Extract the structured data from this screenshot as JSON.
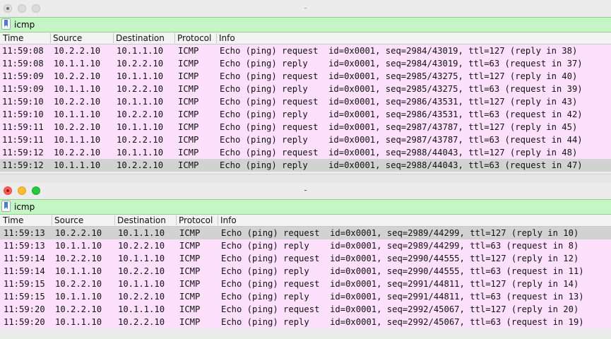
{
  "windows": [
    {
      "title": "-",
      "active": false,
      "filter": "icmp",
      "columns": [
        "Time",
        "Source",
        "Destination",
        "Protocol",
        "Info"
      ],
      "rows": [
        {
          "time": "11:59:08",
          "src": "10.2.2.10",
          "dst": "10.1.1.10",
          "proto": "ICMP",
          "info": "Echo (ping) request  id=0x0001, seq=2984/43019, ttl=127 (reply in 38)",
          "selected": false
        },
        {
          "time": "11:59:08",
          "src": "10.1.1.10",
          "dst": "10.2.2.10",
          "proto": "ICMP",
          "info": "Echo (ping) reply    id=0x0001, seq=2984/43019, ttl=63 (request in 37)",
          "selected": false
        },
        {
          "time": "11:59:09",
          "src": "10.2.2.10",
          "dst": "10.1.1.10",
          "proto": "ICMP",
          "info": "Echo (ping) request  id=0x0001, seq=2985/43275, ttl=127 (reply in 40)",
          "selected": false
        },
        {
          "time": "11:59:09",
          "src": "10.1.1.10",
          "dst": "10.2.2.10",
          "proto": "ICMP",
          "info": "Echo (ping) reply    id=0x0001, seq=2985/43275, ttl=63 (request in 39)",
          "selected": false
        },
        {
          "time": "11:59:10",
          "src": "10.2.2.10",
          "dst": "10.1.1.10",
          "proto": "ICMP",
          "info": "Echo (ping) request  id=0x0001, seq=2986/43531, ttl=127 (reply in 43)",
          "selected": false
        },
        {
          "time": "11:59:10",
          "src": "10.1.1.10",
          "dst": "10.2.2.10",
          "proto": "ICMP",
          "info": "Echo (ping) reply    id=0x0001, seq=2986/43531, ttl=63 (request in 42)",
          "selected": false
        },
        {
          "time": "11:59:11",
          "src": "10.2.2.10",
          "dst": "10.1.1.10",
          "proto": "ICMP",
          "info": "Echo (ping) request  id=0x0001, seq=2987/43787, ttl=127 (reply in 45)",
          "selected": false
        },
        {
          "time": "11:59:11",
          "src": "10.1.1.10",
          "dst": "10.2.2.10",
          "proto": "ICMP",
          "info": "Echo (ping) reply    id=0x0001, seq=2987/43787, ttl=63 (request in 44)",
          "selected": false
        },
        {
          "time": "11:59:12",
          "src": "10.2.2.10",
          "dst": "10.1.1.10",
          "proto": "ICMP",
          "info": "Echo (ping) request  id=0x0001, seq=2988/44043, ttl=127 (reply in 48)",
          "selected": false
        },
        {
          "time": "11:59:12",
          "src": "10.1.1.10",
          "dst": "10.2.2.10",
          "proto": "ICMP",
          "info": "Echo (ping) reply    id=0x0001, seq=2988/44043, ttl=63 (request in 47)",
          "selected": true
        }
      ]
    },
    {
      "title": "-",
      "active": true,
      "filter": "icmp",
      "columns": [
        "Time",
        "Source",
        "Destination",
        "Protocol",
        "Info"
      ],
      "rows": [
        {
          "time": "11:59:13",
          "src": "10.2.2.10",
          "dst": "10.1.1.10",
          "proto": "ICMP",
          "info": "Echo (ping) request  id=0x0001, seq=2989/44299, ttl=127 (reply in 10)",
          "selected": true
        },
        {
          "time": "11:59:13",
          "src": "10.1.1.10",
          "dst": "10.2.2.10",
          "proto": "ICMP",
          "info": "Echo (ping) reply    id=0x0001, seq=2989/44299, ttl=63 (request in 8)",
          "selected": false
        },
        {
          "time": "11:59:14",
          "src": "10.2.2.10",
          "dst": "10.1.1.10",
          "proto": "ICMP",
          "info": "Echo (ping) request  id=0x0001, seq=2990/44555, ttl=127 (reply in 12)",
          "selected": false
        },
        {
          "time": "11:59:14",
          "src": "10.1.1.10",
          "dst": "10.2.2.10",
          "proto": "ICMP",
          "info": "Echo (ping) reply    id=0x0001, seq=2990/44555, ttl=63 (request in 11)",
          "selected": false
        },
        {
          "time": "11:59:15",
          "src": "10.2.2.10",
          "dst": "10.1.1.10",
          "proto": "ICMP",
          "info": "Echo (ping) request  id=0x0001, seq=2991/44811, ttl=127 (reply in 14)",
          "selected": false
        },
        {
          "time": "11:59:15",
          "src": "10.1.1.10",
          "dst": "10.2.2.10",
          "proto": "ICMP",
          "info": "Echo (ping) reply    id=0x0001, seq=2991/44811, ttl=63 (request in 13)",
          "selected": false
        },
        {
          "time": "11:59:20",
          "src": "10.2.2.10",
          "dst": "10.1.1.10",
          "proto": "ICMP",
          "info": "Echo (ping) request  id=0x0001, seq=2992/45067, ttl=127 (reply in 20)",
          "selected": false
        },
        {
          "time": "11:59:20",
          "src": "10.1.1.10",
          "dst": "10.2.2.10",
          "proto": "ICMP",
          "info": "Echo (ping) reply    id=0x0001, seq=2992/45067, ttl=63 (request in 19)",
          "selected": false
        }
      ]
    }
  ],
  "colors": {
    "filter_ok": "#c5f5c5",
    "row_icmp": "#fde0fb",
    "row_selected": "#d2d2d2"
  }
}
